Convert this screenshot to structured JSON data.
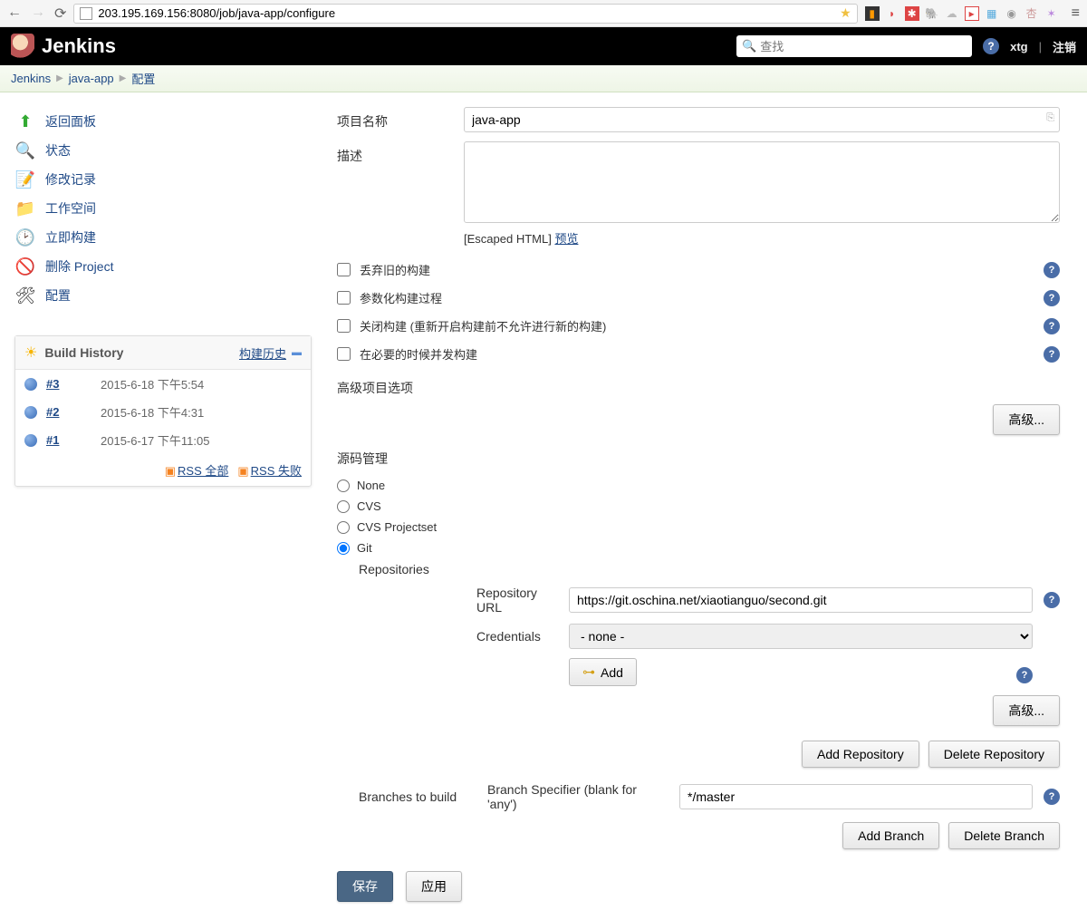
{
  "browser": {
    "url": "203.195.169.156:8080/job/java-app/configure"
  },
  "header": {
    "brand": "Jenkins",
    "search_placeholder": "查找",
    "user": "xtg",
    "logout": "注销"
  },
  "breadcrumb": {
    "c1": "Jenkins",
    "c2": "java-app",
    "c3": "配置"
  },
  "sidebar": {
    "items": [
      {
        "label": "返回面板"
      },
      {
        "label": "状态"
      },
      {
        "label": "修改记录"
      },
      {
        "label": "工作空间"
      },
      {
        "label": "立即构建"
      },
      {
        "label": "删除 Project"
      },
      {
        "label": "配置"
      }
    ],
    "build_history": {
      "title": "Build History",
      "trend": "构建历史",
      "builds": [
        {
          "num": "#3",
          "date": "2015-6-18 下午5:54"
        },
        {
          "num": "#2",
          "date": "2015-6-18 下午4:31"
        },
        {
          "num": "#1",
          "date": "2015-6-17 下午11:05"
        }
      ],
      "rss_all": "RSS 全部",
      "rss_fail": "RSS 失败"
    }
  },
  "form": {
    "project_name_label": "项目名称",
    "project_name_value": "java-app",
    "desc_label": "描述",
    "desc_value": "",
    "escaped_html": "[Escaped HTML] ",
    "preview": "预览",
    "chk_discard": "丢弃旧的构建",
    "chk_param": "参数化构建过程",
    "chk_close": "关闭构建 (重新开启构建前不允许进行新的构建)",
    "chk_concurrent": "在必要的时候并发构建",
    "section_advanced_opts": "高级项目选项",
    "btn_advanced": "高级...",
    "section_scm": "源码管理",
    "scm": {
      "none": "None",
      "cvs": "CVS",
      "cvsps": "CVS Projectset",
      "git": "Git"
    },
    "git": {
      "repositories": "Repositories",
      "repo_url_label": "Repository URL",
      "repo_url_value": "https://git.oschina.net/xiaotianguo/second.git",
      "credentials_label": "Credentials",
      "credentials_value": "- none -",
      "add_btn": "Add",
      "btn_add_repo": "Add Repository",
      "btn_del_repo": "Delete Repository",
      "branches_label": "Branches to build",
      "branch_spec_label": "Branch Specifier (blank for 'any')",
      "branch_spec_value": "*/master",
      "btn_add_branch": "Add Branch",
      "btn_del_branch": "Delete Branch"
    },
    "save": "保存",
    "apply": "应用"
  }
}
